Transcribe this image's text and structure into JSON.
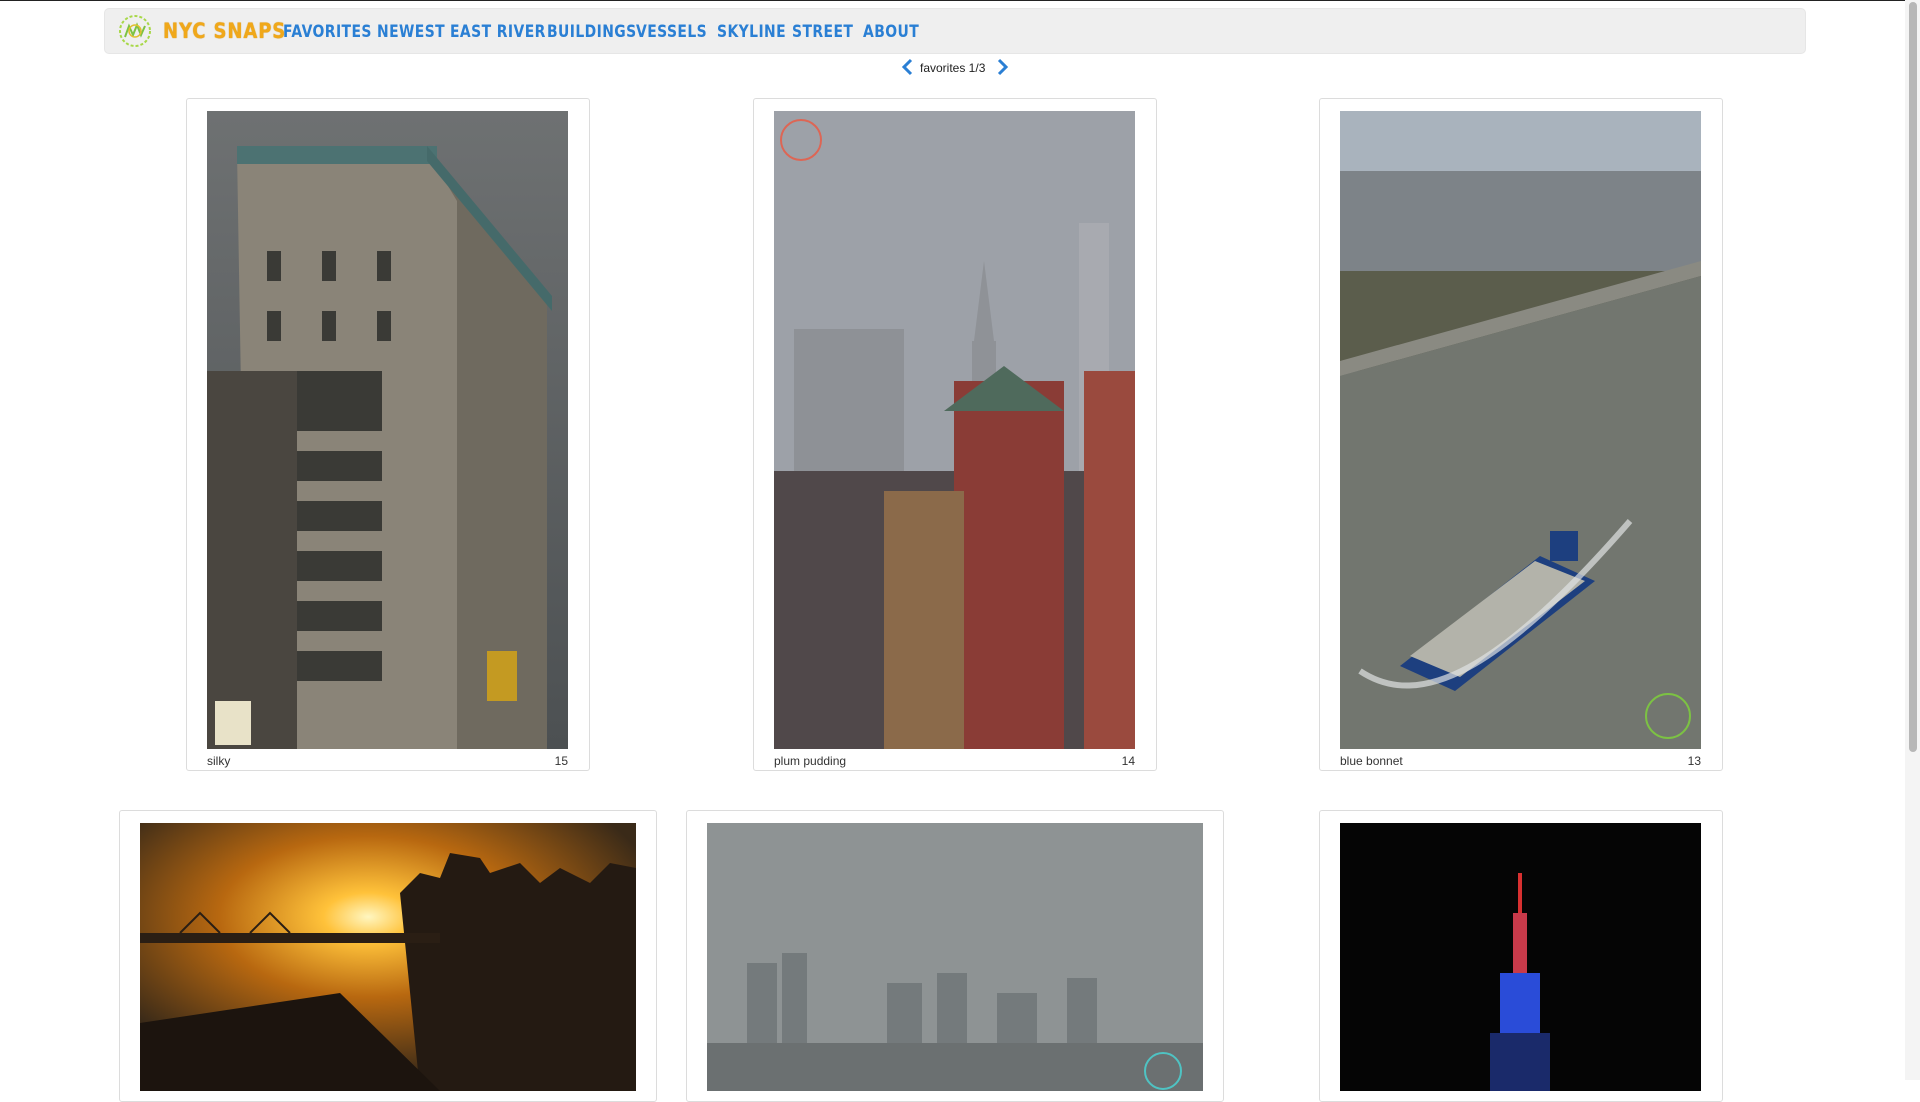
{
  "brand": {
    "name": "NYC SNAPS",
    "logo_icon": "wreath-logo-icon"
  },
  "nav": {
    "items": [
      {
        "label": "FAVORITES"
      },
      {
        "label": "NEWEST"
      },
      {
        "label": "EAST RIVER"
      },
      {
        "label": "BUILDINGS"
      },
      {
        "label": "VESSELS"
      },
      {
        "label": "SKYLINE"
      },
      {
        "label": "STREET"
      },
      {
        "label": "ABOUT"
      }
    ]
  },
  "pager": {
    "text": "favorites 1/3",
    "prev_icon": "chevron-left-icon",
    "next_icon": "chevron-right-icon"
  },
  "photos": [
    {
      "title": "silky",
      "count": "15",
      "subject": "ornate building corner under grey sky"
    },
    {
      "title": "plum pudding",
      "count": "14",
      "subject": "church steeple and skyline in fog"
    },
    {
      "title": "blue bonnet",
      "count": "13",
      "subject": "tug pushing barge on river"
    },
    {
      "title": "",
      "count": "",
      "subject": "sunset over bridge and skyline"
    },
    {
      "title": "",
      "count": "",
      "subject": "foggy skyline"
    },
    {
      "title": "",
      "count": "",
      "subject": "Empire State Building lit at night"
    }
  ],
  "colors": {
    "brand": "#f0a81a",
    "nav": "#2a7fd4",
    "navbar_bg": "#efefef"
  }
}
